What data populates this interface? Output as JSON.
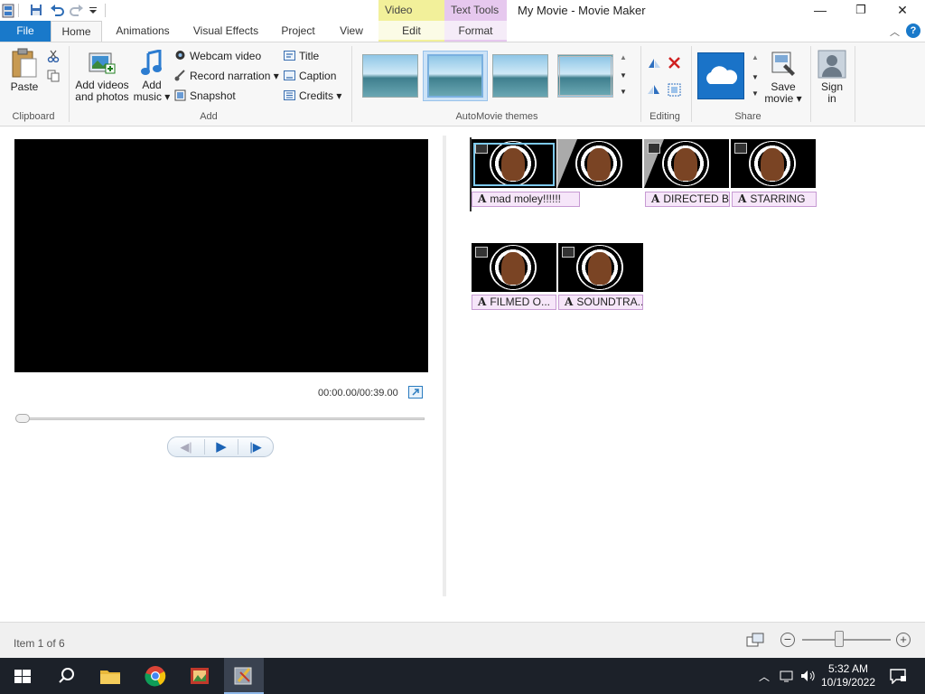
{
  "titlebar": {
    "window_title": "My Movie - Movie Maker",
    "context_video": "Video Tools",
    "context_text": "Text Tools",
    "minimize": "—",
    "maximize": "❐",
    "close": "✕"
  },
  "tabs": {
    "file": "File",
    "home": "Home",
    "animations": "Animations",
    "visual_effects": "Visual Effects",
    "project": "Project",
    "view": "View",
    "edit": "Edit",
    "format": "Format"
  },
  "ribbon": {
    "clipboard": {
      "paste": "Paste",
      "label": "Clipboard"
    },
    "add": {
      "add_videos_line1": "Add videos",
      "add_videos_line2": "and photos",
      "add_music_line1": "Add",
      "add_music_line2": "music ▾",
      "webcam": "Webcam video",
      "narration": "Record narration ▾",
      "snapshot": "Snapshot",
      "title": "Title",
      "caption": "Caption",
      "credits": "Credits ▾",
      "label": "Add"
    },
    "themes": {
      "label": "AutoMovie themes"
    },
    "editing": {
      "label": "Editing"
    },
    "share": {
      "save_line1": "Save",
      "save_line2": "movie ▾",
      "label": "Share"
    },
    "signin": {
      "line1": "Sign",
      "line2": "in"
    }
  },
  "player": {
    "time": "00:00.00/00:39.00",
    "prev": "◀|",
    "play": "▶",
    "next": "|▶"
  },
  "storyboard": {
    "captions": [
      "mad moley!!!!!!",
      "DIRECTED BY",
      "STARRING",
      "FILMED O...",
      "SOUNDTRA..."
    ],
    "caption_glyph": "A"
  },
  "status": {
    "text": "Item 1 of 6"
  },
  "taskbar": {
    "time": "5:32 AM",
    "date": "10/19/2022"
  },
  "colors": {
    "file_tab": "#1979ca",
    "video_tools": "#f2f09a",
    "text_tools": "#e6c8ee",
    "taskbar": "#1c2129"
  }
}
